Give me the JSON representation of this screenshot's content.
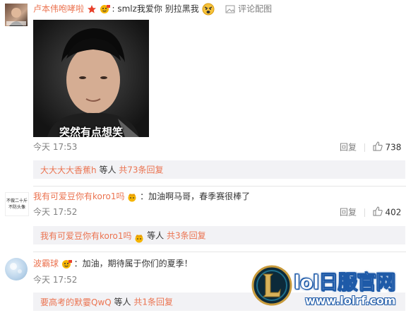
{
  "comments": [
    {
      "username": "卢本伟咆哮啦",
      "text": ": smlz我爱你 别拉黑我",
      "action": "评论配图",
      "image_caption": "突然有点想笑",
      "time": "今天 17:53",
      "reply_label": "回复",
      "likes": "738",
      "sub": {
        "names": "大大大大香蕉h",
        "mid": "等人",
        "count_text": "共73条回复"
      }
    },
    {
      "username": "我有可爱豆你有koro1吗",
      "text": "：加油啊马哥，春季赛很棒了",
      "avatar_text_1": "不做二十斤",
      "avatar_text_2": "不防头像",
      "time": "今天 17:52",
      "reply_label": "回复",
      "likes": "402",
      "sub": {
        "names": "我有可爱豆你有koro1吗",
        "mid": "等人",
        "count_text": "共3条回复"
      }
    },
    {
      "username": "波霸球",
      "text": "：加油，期待属于你们的夏季！",
      "time": "今天 17:52",
      "reply_label": "回复",
      "sub": {
        "names": "要高考的默霎QwQ",
        "mid": "等人",
        "count_text": "共1条回复"
      }
    }
  ],
  "watermark": {
    "title": "lol日服官网",
    "url": "www.lolrf.com"
  },
  "colors": {
    "username": "#eb7350",
    "time": "#808080",
    "subbox_bg": "#f2f2f5",
    "watermark_blue": "#1e5aa8"
  }
}
